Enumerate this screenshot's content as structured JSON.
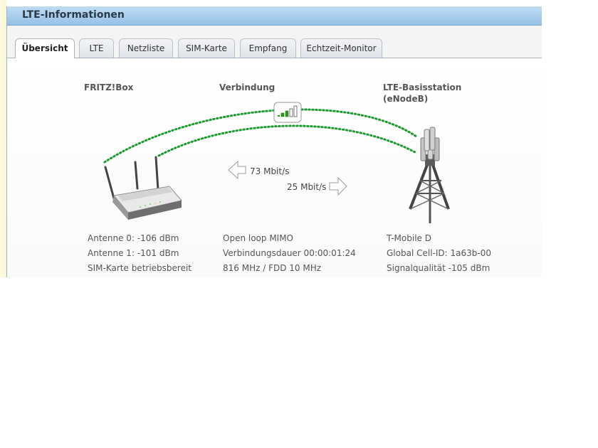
{
  "window": {
    "title": "LTE-Informationen"
  },
  "tabs": [
    {
      "label": "Übersicht",
      "active": true
    },
    {
      "label": "LTE"
    },
    {
      "label": "Netzliste"
    },
    {
      "label": "SIM-Karte"
    },
    {
      "label": "Empfang"
    },
    {
      "label": "Echtzeit-Monitor"
    }
  ],
  "columns": {
    "device": {
      "heading": "FRITZ!Box"
    },
    "connection": {
      "heading": "Verbindung"
    },
    "station": {
      "heading_line1": "LTE-Basisstation",
      "heading_line2": "(eNodeB)"
    }
  },
  "rates": {
    "downlink": "73 Mbit/s",
    "uplink": "25 Mbit/s"
  },
  "device_info": [
    "Antenne 0: -106 dBm",
    "Antenne 1: -101 dBm",
    "SIM-Karte betriebsbereit"
  ],
  "connection_info": [
    "Open loop MIMO",
    "Verbindungsdauer 00:00:01:24",
    "816 MHz / FDD 10 MHz"
  ],
  "station_info": [
    "T-Mobile D",
    "Global Cell-ID: 1a63b-00",
    "Signalqualität -105 dBm"
  ],
  "signal": {
    "bars_total": 5,
    "bars_lit": 3
  },
  "colors": {
    "link_dots": "#1c9a2e",
    "title_bar": "#a8cdec",
    "signal_green": "#2e9a1a"
  },
  "icons": [
    "router-icon",
    "signal-strength-icon",
    "left-arrow-icon",
    "right-arrow-icon",
    "cell-tower-icon"
  ]
}
